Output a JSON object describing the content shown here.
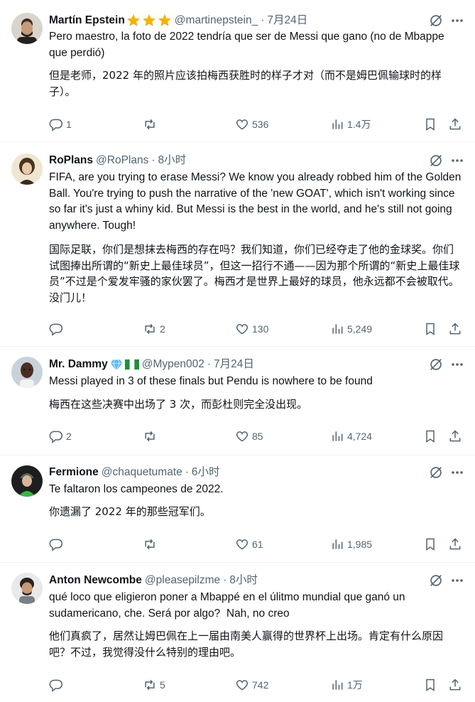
{
  "colors": {
    "text": "#0f1419",
    "muted": "#536471",
    "divider": "#eff3f4",
    "badge_gold": "#f4b400",
    "badge_blue": "#1d9bf0"
  },
  "tweets": [
    {
      "name": "Martín Epstein",
      "badges": [
        "star",
        "star",
        "star"
      ],
      "handle": "@martinepstein_",
      "dot": "·",
      "time": "7月24日",
      "text": "Pero maestro, la foto de 2022 tendría que ser de Messi que gano (no de Mbappe que perdió)",
      "translation": "但是老师，2022 年的照片应该拍梅西获胜时的样子才对（而不是姆巴佩输球时的样子）。",
      "replies": "1",
      "retweets": "",
      "likes": "536",
      "views": "1.4万"
    },
    {
      "name": "RoPlans",
      "badges": [],
      "handle": "@RoPlans",
      "dot": "·",
      "time": "8小时",
      "text": "FIFA, are you trying to erase Messi? We know you already robbed him of the Golden Ball. You're trying to push the narrative of the 'new GOAT', which isn't working since so far it's just a whiny kid. But Messi is the best in the world, and he's still not going anywhere. Tough!",
      "translation": "国际足联，你们是想抹去梅西的存在吗？我们知道，你们已经夺走了他的金球奖。你们试图捧出所谓的“新史上最佳球员”，但这一招行不通——因为那个所谓的“新史上最佳球员”不过是个爱发牢骚的家伙罢了。梅西才是世界上最好的球员，他永远都不会被取代。没门儿！",
      "replies": "",
      "retweets": "2",
      "likes": "130",
      "views": "5,249"
    },
    {
      "name": "Mr. Dammy",
      "badges": [
        "gem",
        "flag"
      ],
      "handle": "@Mypen002",
      "dot": "·",
      "time": "7月24日",
      "text": "Messi played in 3 of these finals but Pendu is nowhere to be found",
      "translation": "梅西在这些决赛中出场了 3 次，而彭杜则完全没出现。",
      "replies": "2",
      "retweets": "",
      "likes": "85",
      "views": "4,724"
    },
    {
      "name": "Fermione",
      "badges": [],
      "handle": "@chaquetumate",
      "dot": "·",
      "time": "6小时",
      "text": "Te faltaron los campeones de 2022.",
      "translation": "你遗漏了 2022 年的那些冠军们。",
      "replies": "",
      "retweets": "",
      "likes": "61",
      "views": "1,985"
    },
    {
      "name": "Anton Newcombe",
      "badges": [],
      "handle": "@pleasepilzme",
      "dot": "·",
      "time": "8小时",
      "text": "qué loco que eligieron poner a Mbappé en el úlitmo mundial que ganó un sudamericano, che. Será por algo?  Nah, no creo",
      "translation": "他们真疯了，居然让姆巴佩在上一届由南美人赢得的世界杯上出场。肯定有什么原因吧？不过，我觉得没什么特别的理由吧。",
      "replies": "",
      "retweets": "5",
      "likes": "742",
      "views": "1万"
    }
  ]
}
